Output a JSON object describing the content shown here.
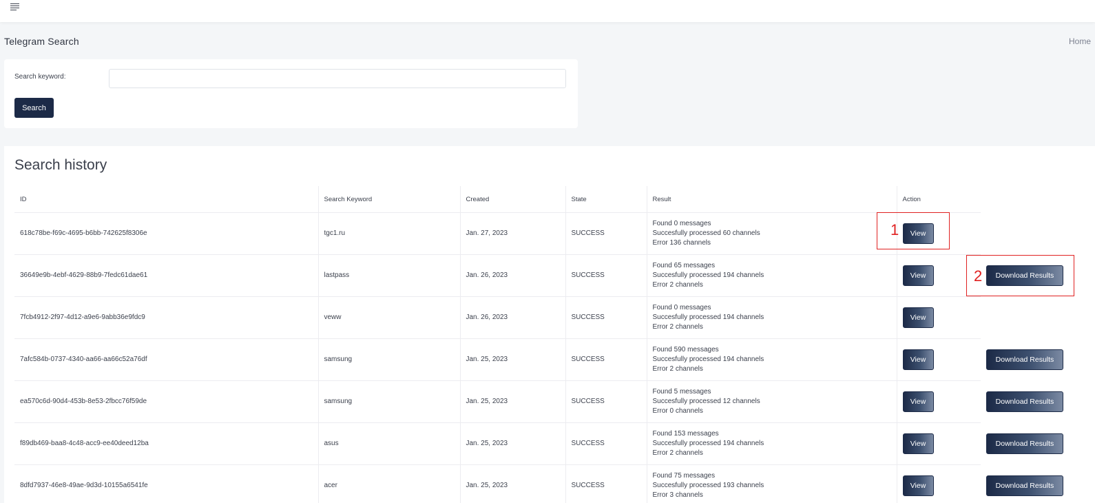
{
  "page": {
    "title": "Telegram Search",
    "breadcrumb": "Home"
  },
  "search": {
    "label": "Search keyword:",
    "value": "",
    "placeholder": "",
    "button_label": "Search"
  },
  "history": {
    "title": "Search history",
    "columns": [
      "ID",
      "Search Keyword",
      "Created",
      "State",
      "Result",
      "Action"
    ],
    "view_label": "View",
    "download_label": "Download Results",
    "rows": [
      {
        "id": "618c78be-f69c-4695-b6bb-742625f8306e",
        "keyword": "tgc1.ru",
        "created": "Jan. 27, 2023",
        "state": "SUCCESS",
        "result": [
          "Found 0 messages",
          "Succesfully processed 60 channels",
          "Error 136 channels"
        ],
        "has_download": false
      },
      {
        "id": "36649e9b-4ebf-4629-88b9-7fedc61dae61",
        "keyword": "lastpass",
        "created": "Jan. 26, 2023",
        "state": "SUCCESS",
        "result": [
          "Found 65 messages",
          "Succesfully processed 194 channels",
          "Error 2 channels"
        ],
        "has_download": true
      },
      {
        "id": "7fcb4912-2f97-4d12-a9e6-9abb36e9fdc9",
        "keyword": "veww",
        "created": "Jan. 26, 2023",
        "state": "SUCCESS",
        "result": [
          "Found 0 messages",
          "Succesfully processed 194 channels",
          "Error 2 channels"
        ],
        "has_download": false
      },
      {
        "id": "7afc584b-0737-4340-aa66-aa66c52a76df",
        "keyword": "samsung",
        "created": "Jan. 25, 2023",
        "state": "SUCCESS",
        "result": [
          "Found 590 messages",
          "Succesfully processed 194 channels",
          "Error 2 channels"
        ],
        "has_download": true
      },
      {
        "id": "ea570c6d-90d4-453b-8e53-2fbcc76f59de",
        "keyword": "samsung",
        "created": "Jan. 25, 2023",
        "state": "SUCCESS",
        "result": [
          "Found 5 messages",
          "Succesfully processed 12 channels",
          "Error 0 channels"
        ],
        "has_download": true
      },
      {
        "id": "f89db469-baa8-4c48-acc9-ee40deed12ba",
        "keyword": "asus",
        "created": "Jan. 25, 2023",
        "state": "SUCCESS",
        "result": [
          "Found 153 messages",
          "Succesfully processed 194 channels",
          "Error 2 channels"
        ],
        "has_download": true
      },
      {
        "id": "8dfd7937-46e8-49ae-9d3d-10155a6541fe",
        "keyword": "acer",
        "created": "Jan. 25, 2023",
        "state": "SUCCESS",
        "result": [
          "Found 75 messages",
          "Succesfully processed 193 channels",
          "Error 3 channels"
        ],
        "has_download": true
      }
    ]
  },
  "annotations": {
    "one": "1",
    "two": "2",
    "color": "#e02020"
  },
  "colors": {
    "primary": "#1c2a47",
    "background": "#f4f6f8"
  }
}
